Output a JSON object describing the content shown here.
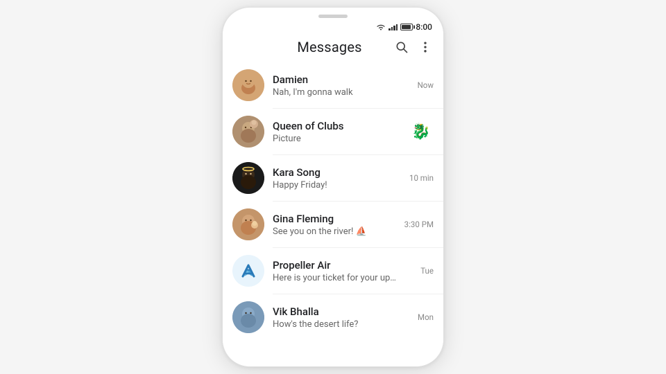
{
  "statusBar": {
    "time": "8:00"
  },
  "appBar": {
    "title": "Messages",
    "searchLabel": "Search",
    "moreLabel": "More options"
  },
  "conversations": [
    {
      "id": "damien",
      "name": "Damien",
      "preview": "Nah, I'm gonna walk",
      "time": "Now",
      "hasThumb": false,
      "avatarLabel": "D"
    },
    {
      "id": "queen",
      "name": "Queen of Clubs",
      "preview": "Picture",
      "time": "",
      "hasThumb": true,
      "thumbEmoji": "🐉",
      "avatarLabel": "Q"
    },
    {
      "id": "kara",
      "name": "Kara Song",
      "preview": "Happy Friday!",
      "time": "10 min",
      "hasThumb": false,
      "avatarLabel": "K"
    },
    {
      "id": "gina",
      "name": "Gina Fleming",
      "preview": "See you on the river! ⛵",
      "time": "3:30 PM",
      "hasThumb": false,
      "avatarLabel": "G"
    },
    {
      "id": "propeller",
      "name": "Propeller Air",
      "preview": "Here is your ticket for your upcoming...",
      "time": "Tue",
      "hasThumb": false,
      "avatarLabel": "P"
    },
    {
      "id": "vik",
      "name": "Vik Bhalla",
      "preview": "How's the desert life?",
      "time": "Mon",
      "hasThumb": false,
      "avatarLabel": "V"
    }
  ]
}
